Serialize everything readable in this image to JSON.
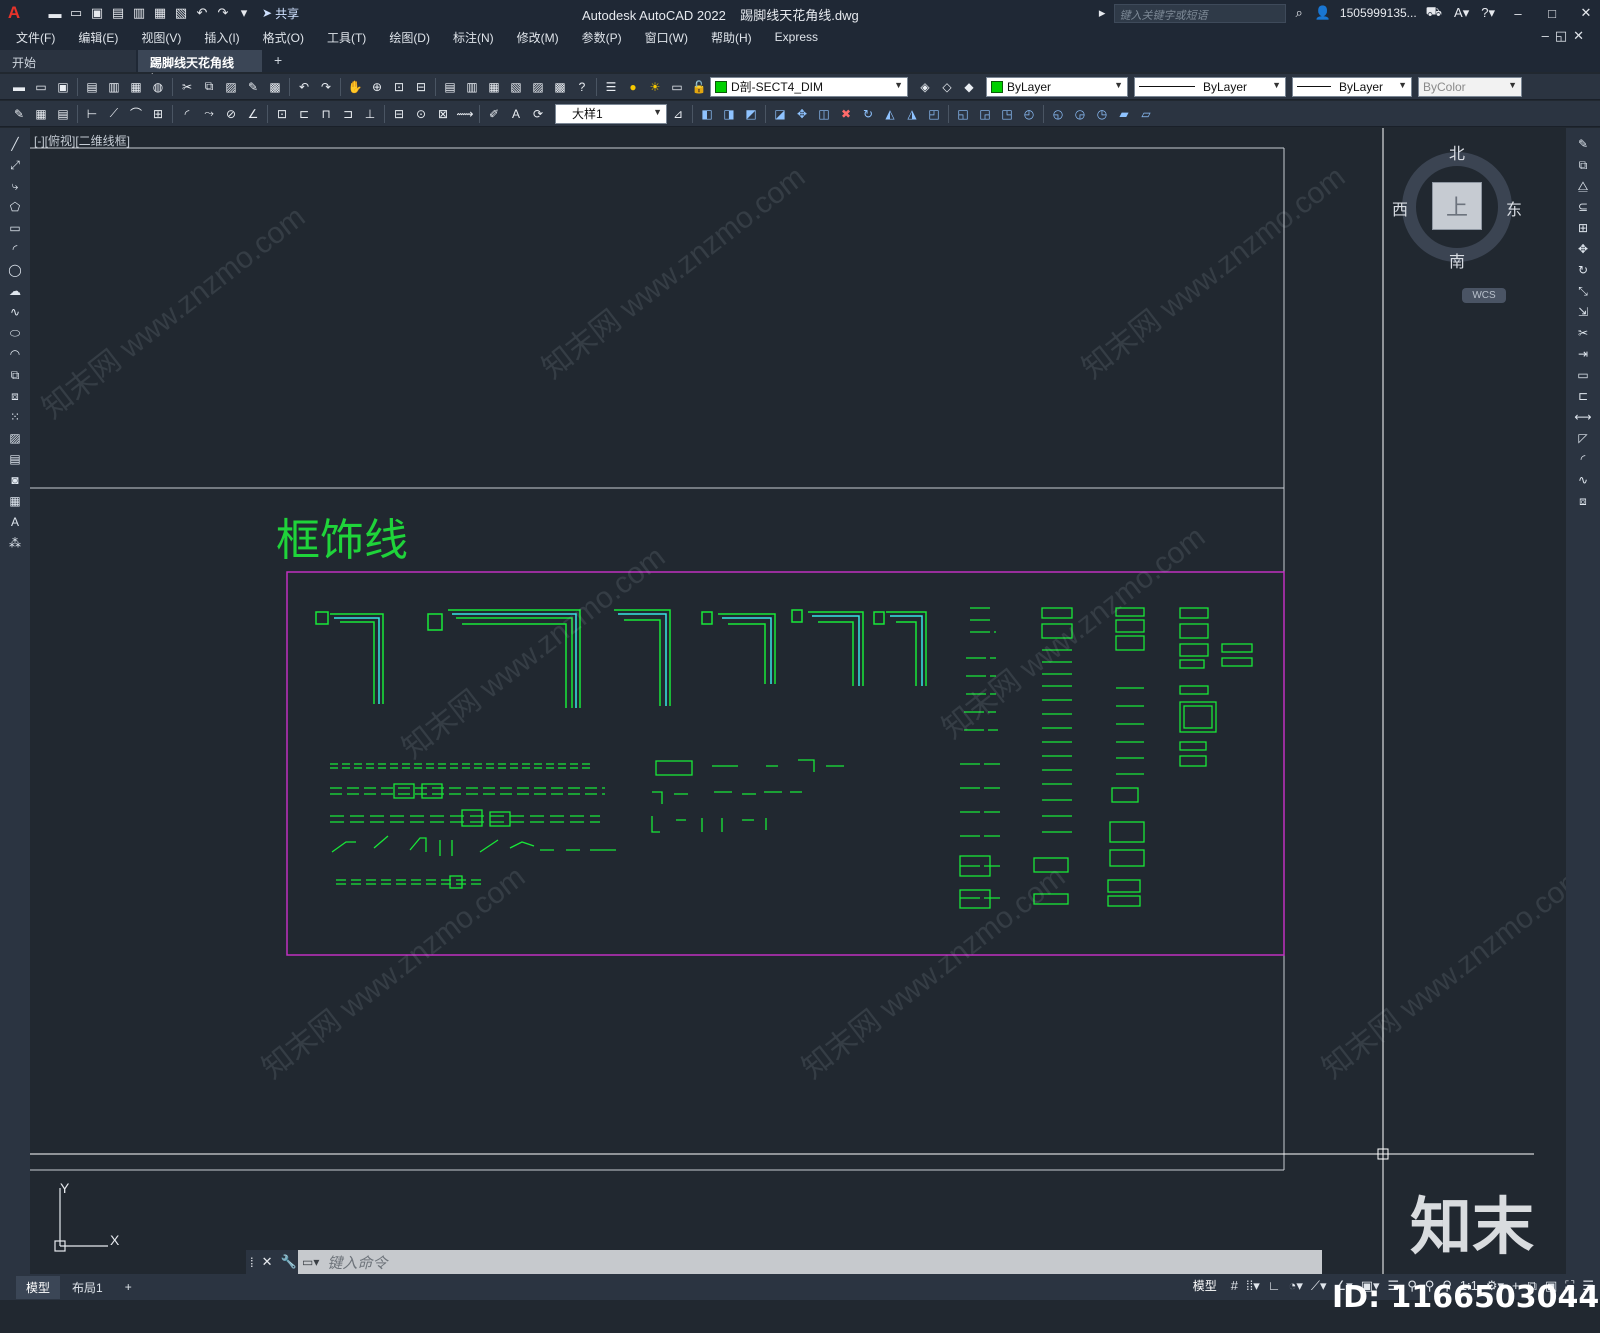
{
  "app": {
    "logo": "A",
    "title": "Autodesk AutoCAD 2022",
    "file_name": "踢脚线天花角线.dwg",
    "share_label": "共享",
    "search_placeholder": "键入关键字或短语",
    "user": "1505999135...",
    "window_controls": [
      "–",
      "□",
      "✕"
    ]
  },
  "menu": {
    "items": [
      "文件(F)",
      "编辑(E)",
      "视图(V)",
      "插入(I)",
      "格式(O)",
      "工具(T)",
      "绘图(D)",
      "标注(N)",
      "修改(M)",
      "参数(P)",
      "窗口(W)",
      "帮助(H)",
      "Express"
    ],
    "right_controls": "–◱✕"
  },
  "tabs": {
    "start": "开始",
    "active": "踢脚线天花角线*",
    "close": "✕",
    "add": "+"
  },
  "toolbar": {
    "layer": "D剖-SECT4_DIM",
    "color": "ByLayer",
    "linetype": "ByLayer",
    "lineweight": "ByLayer",
    "plotstyle": "ByColor",
    "dim_style": "大样1",
    "layer_color": "#00d000"
  },
  "viewport": {
    "label": "[-][俯视][二维线框]"
  },
  "drawing": {
    "title": "框饰线",
    "title_color": "#1fd43a",
    "frame_color": "#c030c0",
    "line_color": "#18e838",
    "cyan_color": "#38e6e6",
    "crosshair_color": "#ffffff"
  },
  "viewcube": {
    "north": "北",
    "south": "南",
    "east": "东",
    "west": "西",
    "face": "上",
    "wcs": "WCS"
  },
  "ucs": {
    "x": "X",
    "y": "Y"
  },
  "command": {
    "close": "✕",
    "prompt": "键入命令"
  },
  "status": {
    "tabs": [
      "模型",
      "布局1"
    ],
    "add": "+",
    "model_button": "模型",
    "scale": "1:1"
  },
  "watermark": {
    "brand": "知末",
    "id": "ID: 1166503044",
    "site": "知末网 www.znzmo.com"
  }
}
